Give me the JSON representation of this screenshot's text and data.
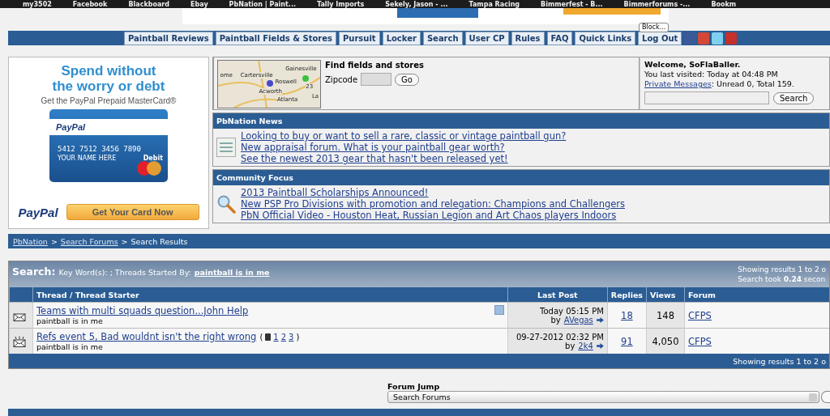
{
  "bookmarks": [
    {
      "label": "my3502"
    },
    {
      "label": "Facebook"
    },
    {
      "label": "Blackboard"
    },
    {
      "label": "Ebay"
    },
    {
      "label": "PbNation | Paint..."
    },
    {
      "label": "Tally Imports"
    },
    {
      "label": "Sekely, Jason - ..."
    },
    {
      "label": "Tampa Racing"
    },
    {
      "label": "Bimmerfest - B..."
    },
    {
      "label": "Bimmerforums -..."
    },
    {
      "label": "Bookm"
    }
  ],
  "top_ad": {
    "tooltip": "Block..."
  },
  "nav": {
    "items": [
      "Paintball Reviews",
      "Paintball Fields & Stores",
      "Pursuit",
      "Locker",
      "Search",
      "User CP",
      "Rules",
      "FAQ",
      "Quick Links",
      "Log Out"
    ]
  },
  "ad": {
    "headline": [
      "Spend without",
      "the worry or debt"
    ],
    "subline": "Get the PayPal Prepaid MasterCard®",
    "card_brand": "PayPal",
    "card_number": "5412 7512 3456 7890",
    "card_debit": "Debit",
    "card_name": "YOUR NAME HERE",
    "logo": "PayPal",
    "button": "Get Your Card Now"
  },
  "locator": {
    "map_labels": [
      "ome",
      "Cartersville",
      "Gainesville",
      "Roswell",
      "Acworth",
      "Atlanta",
      "La",
      "23"
    ],
    "title": "Find fields and stores",
    "zip_label": "Zipcode",
    "go": "Go"
  },
  "welcome": {
    "greeting": "Welcome, SoFlaBaller.",
    "last_visited": "You last visited: Today at 04:48 PM",
    "pm_link": "Private Messages",
    "pm_text": ": Unread 0, Total 159.",
    "search_button": "Search"
  },
  "news": {
    "title": "PbNation News",
    "links": [
      "Looking to buy or want to sell a rare, classic or vintage paintball gun?",
      "New appraisal forum. What is your paintball gear worth?",
      "See the newest 2013 gear that hasn't been released yet!"
    ]
  },
  "community": {
    "title": "Community Focus",
    "links": [
      "2013 Paintball Scholarships Announced!",
      "New PSP Pro Divisions with promotion and relegation: Champions and Challengers",
      "PbN Official Video - Houston Heat, Russian Legion and Art Chaos players Indoors"
    ]
  },
  "breadcrumb": {
    "separator": ">",
    "items": [
      {
        "label": "PbNation",
        "link": true
      },
      {
        "label": "Search Forums",
        "link": true
      },
      {
        "label": "Search Results",
        "link": false
      }
    ]
  },
  "results": {
    "heading": "Search:",
    "criteria": "Key Word(s): ; Threads Started By:",
    "starter_link": "paintball is in me",
    "showing": "Showing results 1 to 2 o",
    "took": "Search took **0.24** secon",
    "columns": [
      "Thread / Thread Starter",
      "Last Post",
      "Replies",
      "Views",
      "Forum"
    ],
    "rows": [
      {
        "hot": false,
        "title": "Teams with multi squads question...John Help",
        "pages": [],
        "starter": "paintball is in me",
        "subscribed": true,
        "last_post_date": "Today 05:15 PM",
        "by_label": "by",
        "last_post_by": "AVegas",
        "replies": "18",
        "views": "148",
        "forum": "CFPS"
      },
      {
        "hot": true,
        "title": "Refs event 5, Bad wouldnt isn't the right wrong",
        "pages_open": "(",
        "pages": [
          "1",
          "2",
          "3"
        ],
        "pages_close": ")",
        "starter": "paintball is in me",
        "subscribed": false,
        "last_post_date": "09-27-2012 02:32 PM",
        "by_label": "by",
        "last_post_by": "2k4",
        "replies": "91",
        "views": "4,050",
        "forum": "CFPS"
      }
    ],
    "footer": "Showing results 1 to 2 o"
  },
  "forum_jump": {
    "label": "Forum Jump",
    "value": "Search Forums"
  }
}
